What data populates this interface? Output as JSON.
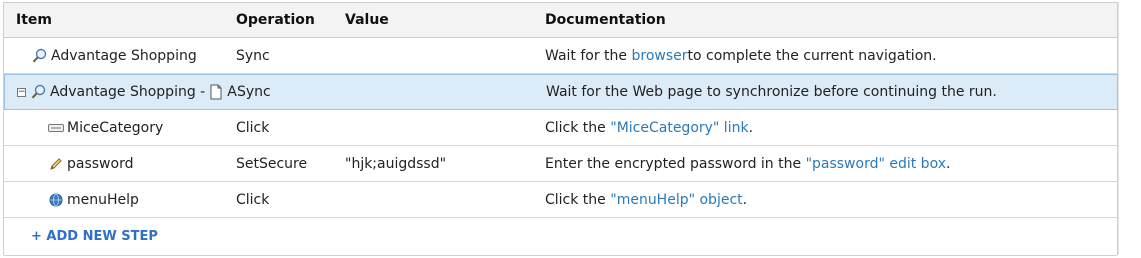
{
  "columns": {
    "item": "Item",
    "operation": "Operation",
    "value": "Value",
    "documentation": "Documentation"
  },
  "rows": [
    {
      "item": "Advantage Shopping",
      "operation": "Sync",
      "value": "",
      "doc_pre": "Wait for the ",
      "doc_link": "browser",
      "doc_post": " to complete the current navigation."
    },
    {
      "item_a": "Advantage Shopping - ",
      "item_b": "A",
      "operation": "Sync",
      "value": "",
      "doc_pre": "Wait for the Web page to synchronize before continuing the run.",
      "doc_link": "",
      "doc_post": ""
    },
    {
      "item": "MiceCategory",
      "operation": "Click",
      "value": "",
      "doc_pre": "Click the ",
      "doc_link": "\"MiceCategory\" link",
      "doc_post": "."
    },
    {
      "item": "password",
      "operation": "SetSecure",
      "value": "\"hjk;auigdssd\"",
      "doc_pre": "Enter the encrypted password in the ",
      "doc_link": "\"password\" edit box",
      "doc_post": "."
    },
    {
      "item": "menuHelp",
      "operation": "Click",
      "value": "",
      "doc_pre": "Click the ",
      "doc_link": "\"menuHelp\" object",
      "doc_post": "."
    }
  ],
  "add_step_label": "+ ADD NEW STEP",
  "colors": {
    "selected_row": "#dcebf8",
    "link": "#2a7ab8",
    "add_step": "#2f6fc8"
  }
}
